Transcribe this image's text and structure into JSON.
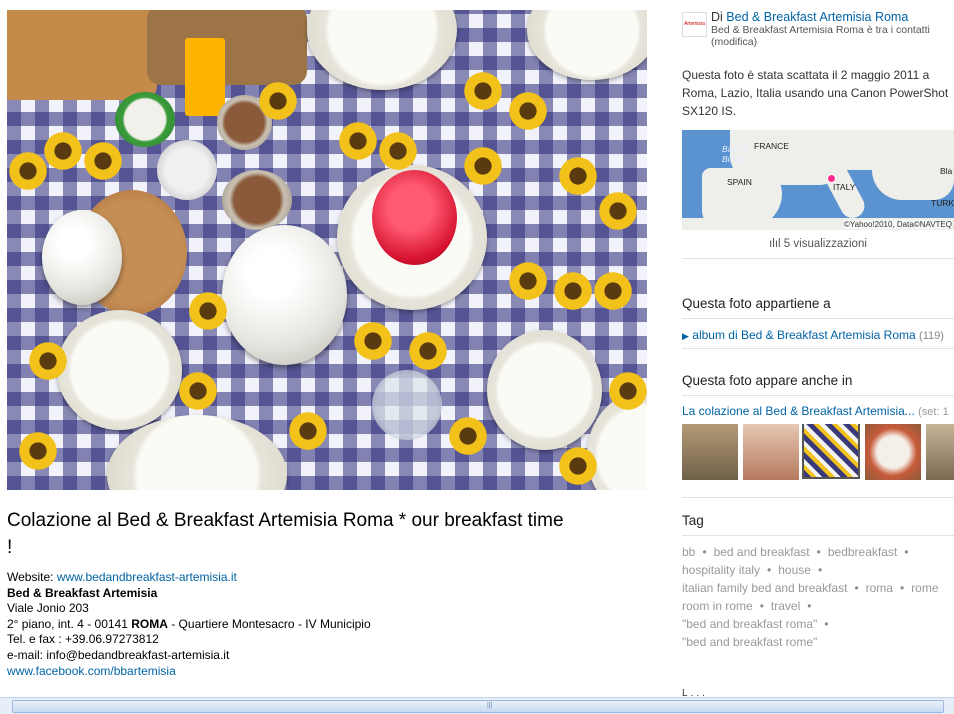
{
  "photo": {
    "alt_label": ""
  },
  "title": "Colazione al Bed & Breakfast Artemisia Roma * our breakfast time !",
  "description": {
    "website_label": "Website: ",
    "website_url": "www.bedandbreakfast-artemisia.it",
    "name": "Bed & Breakfast Artemisia",
    "street": "Viale Jonio 203",
    "floor_prefix": "2° piano, int. 4 - 00141 ",
    "city": "ROMA",
    "floor_suffix": " - Quartiere Montesacro - IV Municipio",
    "phone": "Tel. e fax : +39.06.97273812",
    "email": "e-mail: info@bedandbreakfast-artemisia.it",
    "facebook": "www.facebook.com/bbartemisia"
  },
  "owner": {
    "by_prefix": "Di ",
    "name": "Bed & Breakfast Artemisia Roma",
    "note": "Bed & Breakfast Artemisia Roma è tra i contatti (modifica)",
    "logo_text": "Artemisia"
  },
  "taken": "Questa foto è stata scattata il 2 maggio 2011 a Roma, Lazio, Italia usando una Canon PowerShot SX120 IS.",
  "map": {
    "labels": [
      "Bay Of Biscay",
      "FRANCE",
      "SPAIN",
      "ITALY",
      "TURK",
      "Bla"
    ],
    "credit": "©Yahoo!2010, Data©NAVTEQ"
  },
  "views": "5 visualizzazioni",
  "belongs": {
    "heading": "Questa foto appartiene a",
    "album_label": "album di Bed & Breakfast Artemisia Roma",
    "album_count": "(119)"
  },
  "appears": {
    "heading": "Questa foto appare anche in",
    "set_label": "La colazione al Bed & Breakfast Artemisia...",
    "set_count": "(set: 1"
  },
  "tags": {
    "heading": "Tag",
    "items": [
      "bb",
      "bed and breakfast",
      "bedbreakfast",
      "hospitality italy",
      "house",
      "italian family bed and breakfast",
      "roma",
      "rome",
      "room in rome",
      "travel",
      "\"bed and breakfast roma\"",
      "\"bed and breakfast rome\""
    ]
  },
  "partial_heading": "L..."
}
